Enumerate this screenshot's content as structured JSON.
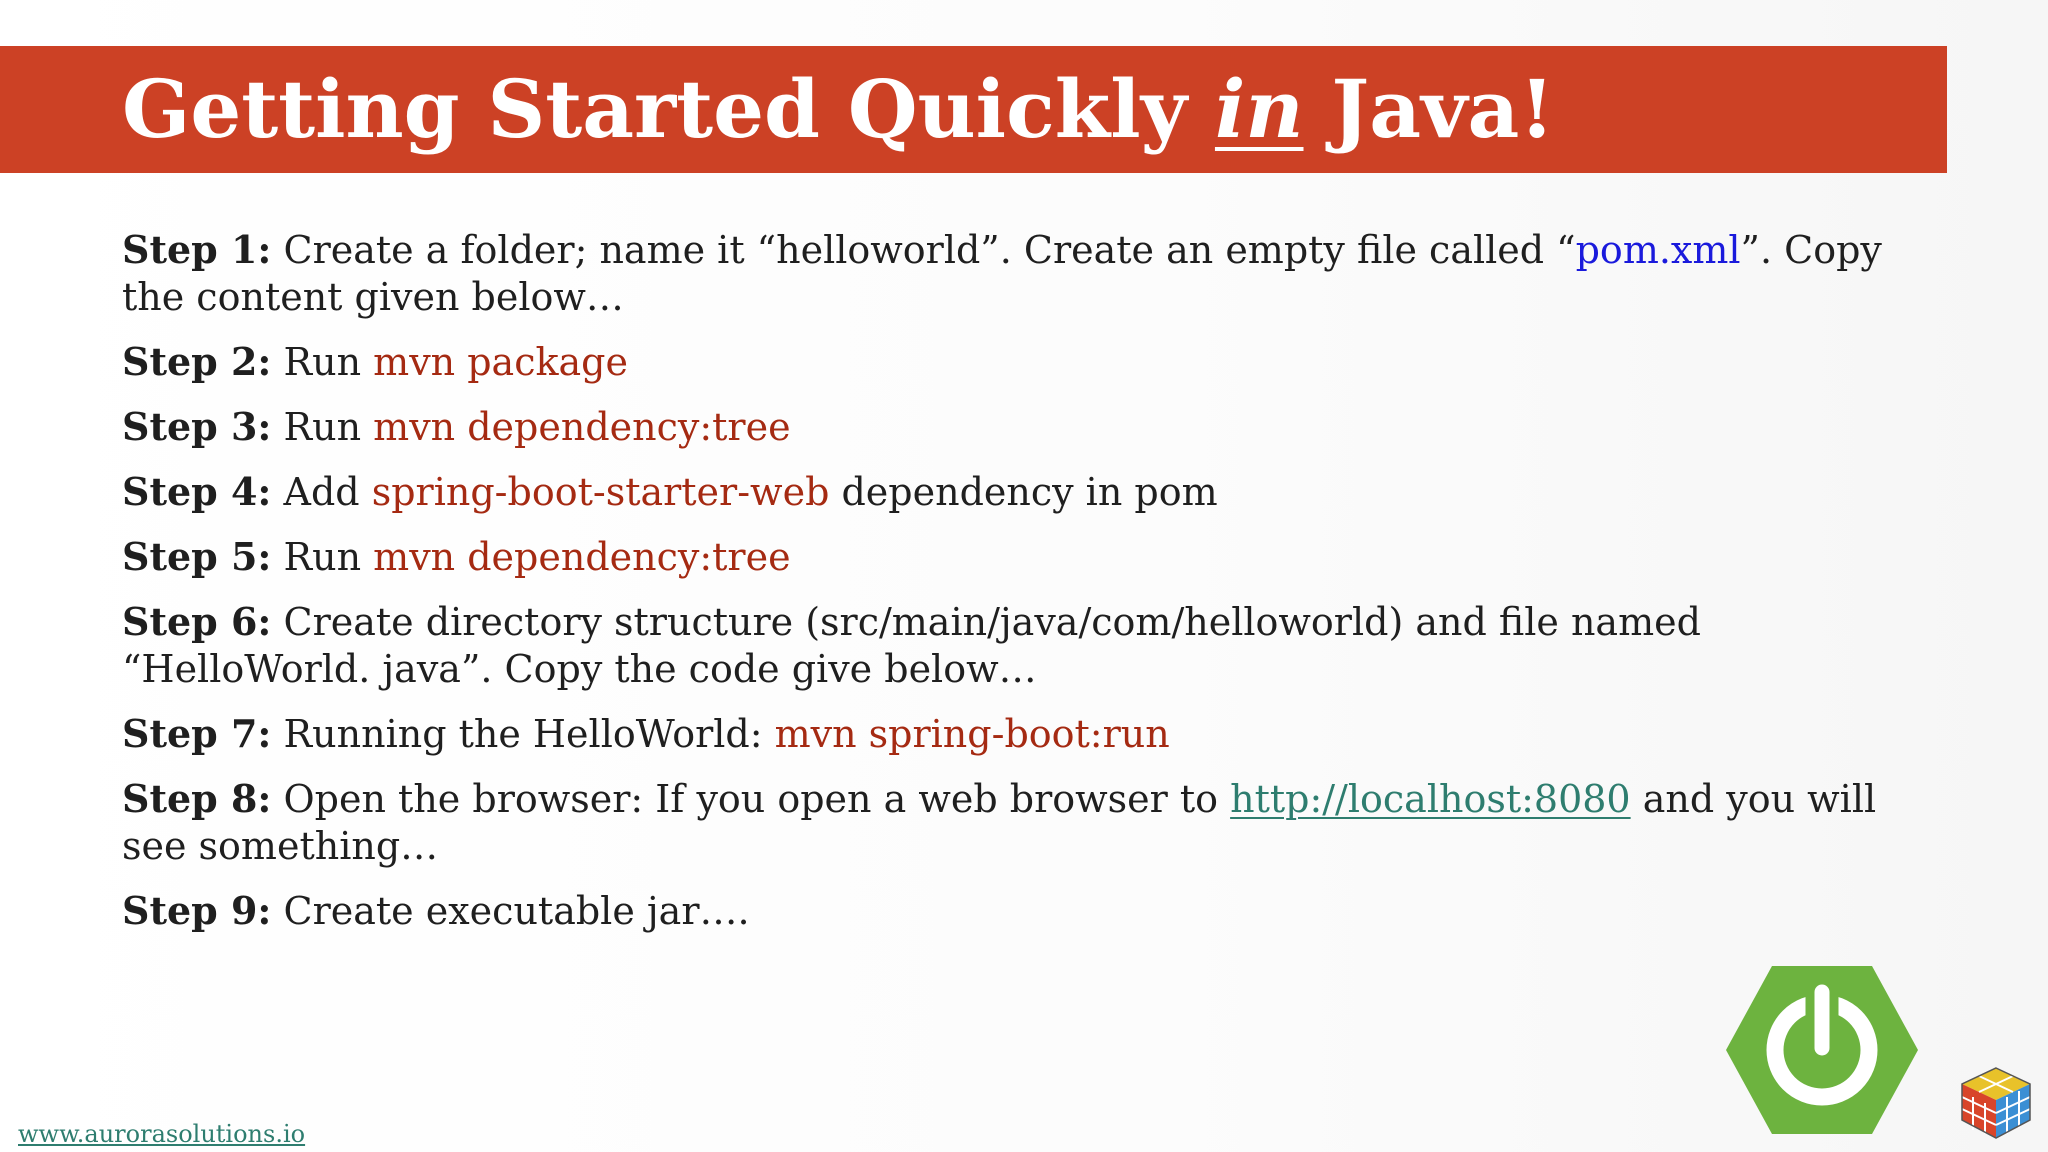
{
  "title": {
    "before": "Getting Started Quickly ",
    "emphasis": "in",
    "after": " Java!"
  },
  "steps": [
    {
      "label": "Step 1:",
      "text1": " Create a folder; name it “helloworld”. Create an empty file called “",
      "file": "pom.xml",
      "text2": "”. Copy the content given below…"
    },
    {
      "label": "Step 2:",
      "text1": " Run ",
      "cmd": "mvn package"
    },
    {
      "label": "Step 3:",
      "text1": " Run ",
      "cmd": "mvn dependency:tree"
    },
    {
      "label": "Step 4:",
      "text1": " Add ",
      "cmd": "spring-boot-starter-web",
      "text2": " dependency in pom"
    },
    {
      "label": "Step 5:",
      "text1": " Run ",
      "cmd": "mvn dependency:tree"
    },
    {
      "label": "Step 6:",
      "text1": " Create directory structure (src/main/java/com/helloworld) and file named “HelloWorld. java”. Copy the code give below…"
    },
    {
      "label": "Step 7:",
      "text1": " Running the HelloWorld:  ",
      "cmd": "mvn spring-boot:run"
    },
    {
      "label": "Step 8:",
      "text1": " Open the browser: If you open a web browser to ",
      "link": "http://localhost:8080",
      "text2": " and you will see something…"
    },
    {
      "label": "Step 9:",
      "text1": " Create executable jar…."
    }
  ],
  "footer": {
    "website": "www.aurorasolutions.io"
  },
  "icons": {
    "spring": "spring-power-logo-icon",
    "cube": "rubiks-cube-logo-icon"
  },
  "colors": {
    "title_bar": "#cc4125",
    "command": "#a52a12",
    "file_link": "#1a1adc",
    "url_link": "#2e7d6f",
    "spring_green": "#6db33f"
  }
}
